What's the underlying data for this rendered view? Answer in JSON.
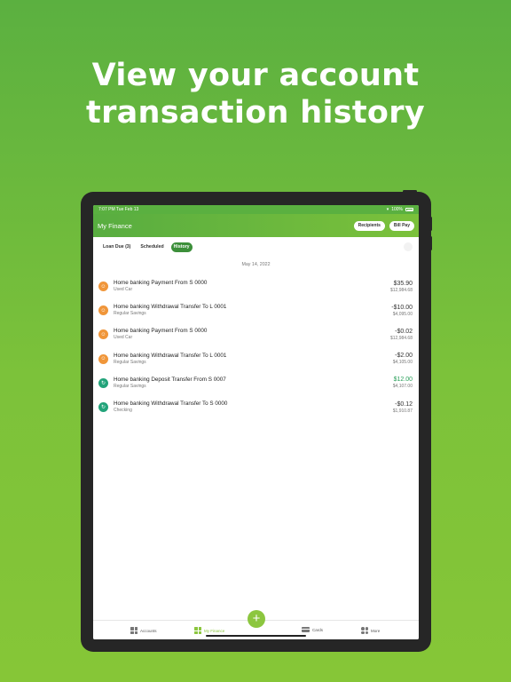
{
  "promo": {
    "line1": "View your account",
    "line2": "transaction history"
  },
  "status_bar": {
    "time": "7:07 PM  Tue Feb 13",
    "battery": "100%"
  },
  "header": {
    "title": "My Finance",
    "recipients_label": "Recipients",
    "bill_pay_label": "Bill Pay"
  },
  "tabs": [
    {
      "label": "Loan Due (3)",
      "active": false
    },
    {
      "label": "Scheduled",
      "active": false
    },
    {
      "label": "History",
      "active": true
    }
  ],
  "date_group": "May 14, 2022",
  "transactions": [
    {
      "title": "Home banking Payment From S 0000",
      "account": "Used Car",
      "amount": "$35.90",
      "balance": "$12,984.68",
      "icon": "person-icon",
      "color": "#f0963a",
      "credit": false
    },
    {
      "title": "Home banking Withdrawal Transfer To L 0001",
      "account": "Regular Savings",
      "amount": "-$10.00",
      "balance": "$4,095.00",
      "icon": "person-icon",
      "color": "#f0963a",
      "credit": false
    },
    {
      "title": "Home banking Payment From S 0000",
      "account": "Used Car",
      "amount": "-$0.02",
      "balance": "$12,984.68",
      "icon": "person-icon",
      "color": "#f0963a",
      "credit": false
    },
    {
      "title": "Home banking Withdrawal Transfer To L 0001",
      "account": "Regular Savings",
      "amount": "-$2.00",
      "balance": "$4,105.00",
      "icon": "person-icon",
      "color": "#f0963a",
      "credit": false
    },
    {
      "title": "Home banking Deposit Transfer From S 0007",
      "account": "Regular Savings",
      "amount": "$12.00",
      "balance": "$4,107.00",
      "icon": "transfer-icon",
      "color": "#22a37a",
      "credit": true
    },
    {
      "title": "Home banking Withdrawal Transfer To S 0000",
      "account": "Checking",
      "amount": "-$0.12",
      "balance": "$1,910.87",
      "icon": "transfer-icon",
      "color": "#22a37a",
      "credit": false
    }
  ],
  "nav": {
    "accounts": "Accounts",
    "my_finance": "My Finance",
    "cards": "Cards",
    "more": "More",
    "add_symbol": "+"
  },
  "colors": {
    "brand_green": "#5ab040",
    "accent_lime": "#8cc63f",
    "credit_green": "#2aa05a",
    "orange": "#f0963a",
    "teal": "#22a37a"
  }
}
